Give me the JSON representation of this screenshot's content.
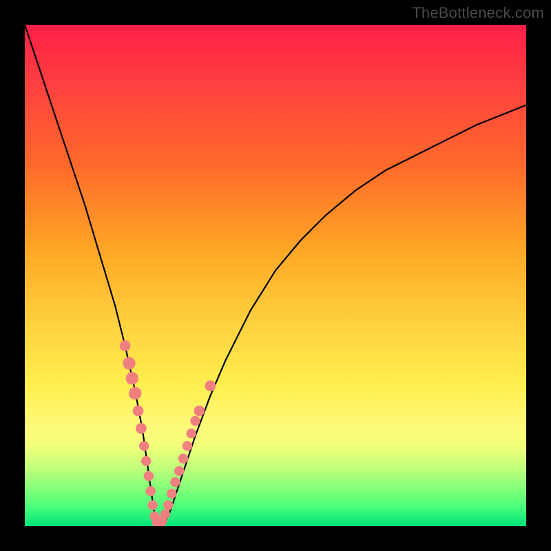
{
  "watermark": "TheBottleneck.com",
  "chart_data": {
    "type": "line",
    "title": "",
    "xlabel": "",
    "ylabel": "",
    "xlim": [
      0,
      100
    ],
    "ylim": [
      0,
      100
    ],
    "series": [
      {
        "name": "curve",
        "x": [
          0,
          3,
          6,
          9,
          12,
          15,
          18,
          20,
          22,
          23.5,
          24.5,
          25.2,
          25.8,
          26.3,
          27,
          28,
          29,
          30,
          32,
          34,
          37,
          40,
          45,
          50,
          55,
          60,
          66,
          72,
          80,
          90,
          100
        ],
        "y": [
          100,
          91,
          82,
          73,
          64,
          54,
          44,
          36,
          27,
          19,
          12,
          7,
          3,
          0.8,
          0.2,
          0.8,
          3,
          6,
          12,
          18,
          26,
          33,
          43,
          51,
          57,
          62,
          67,
          71,
          75,
          80,
          84
        ]
      }
    ],
    "markers": {
      "name": "highlight-dots",
      "color_hex": "#f08080",
      "points": [
        {
          "x": 20.0,
          "y": 36.0,
          "r": 1.2
        },
        {
          "x": 20.8,
          "y": 32.5,
          "r": 1.4
        },
        {
          "x": 21.4,
          "y": 29.5,
          "r": 1.4
        },
        {
          "x": 22.0,
          "y": 26.5,
          "r": 1.4
        },
        {
          "x": 22.6,
          "y": 23.0,
          "r": 1.2
        },
        {
          "x": 23.2,
          "y": 19.5,
          "r": 1.2
        },
        {
          "x": 23.8,
          "y": 16.0,
          "r": 1.1
        },
        {
          "x": 24.2,
          "y": 13.0,
          "r": 1.1
        },
        {
          "x": 24.7,
          "y": 10.0,
          "r": 1.1
        },
        {
          "x": 25.1,
          "y": 7.0,
          "r": 1.1
        },
        {
          "x": 25.5,
          "y": 4.2,
          "r": 1.1
        },
        {
          "x": 25.9,
          "y": 2.0,
          "r": 1.1
        },
        {
          "x": 26.3,
          "y": 0.8,
          "r": 1.1
        },
        {
          "x": 26.8,
          "y": 0.3,
          "r": 1.1
        },
        {
          "x": 27.4,
          "y": 1.0,
          "r": 1.1
        },
        {
          "x": 28.0,
          "y": 2.4,
          "r": 1.1
        },
        {
          "x": 28.6,
          "y": 4.2,
          "r": 1.1
        },
        {
          "x": 29.3,
          "y": 6.5,
          "r": 1.1
        },
        {
          "x": 30.0,
          "y": 8.8,
          "r": 1.1
        },
        {
          "x": 30.8,
          "y": 11.0,
          "r": 1.1
        },
        {
          "x": 31.6,
          "y": 13.5,
          "r": 1.1
        },
        {
          "x": 32.4,
          "y": 16.0,
          "r": 1.1
        },
        {
          "x": 33.2,
          "y": 18.5,
          "r": 1.1
        },
        {
          "x": 34.0,
          "y": 21.0,
          "r": 1.1
        },
        {
          "x": 34.8,
          "y": 23.0,
          "r": 1.2
        },
        {
          "x": 37.0,
          "y": 28.0,
          "r": 1.2
        }
      ]
    }
  }
}
